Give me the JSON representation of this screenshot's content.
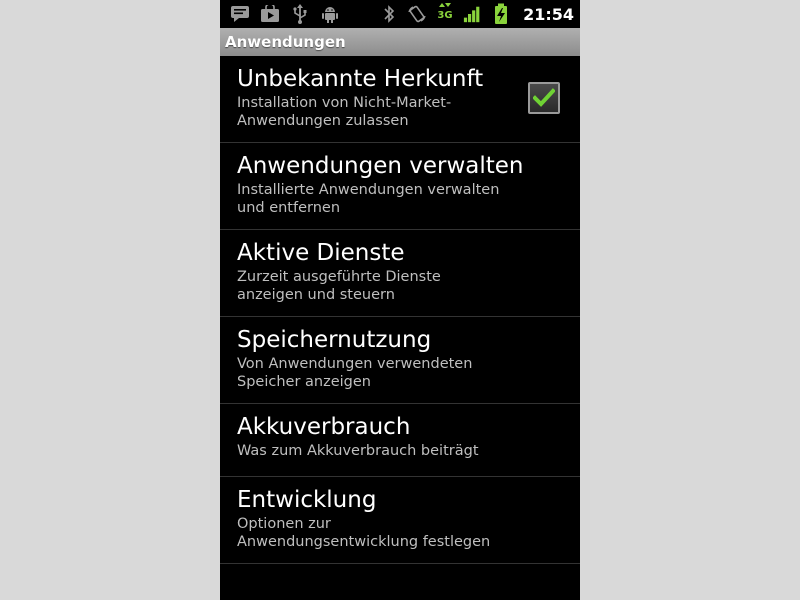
{
  "status_bar": {
    "left_icons": [
      "message-icon",
      "market-icon",
      "usb-icon",
      "android-debug-icon"
    ],
    "right_icons": [
      "bluetooth-icon",
      "rotate-icon",
      "network-3g-icon",
      "signal-icon",
      "battery-charging-icon"
    ],
    "network_type": "3G",
    "time": "21:54"
  },
  "title_bar": {
    "title": "Anwendungen"
  },
  "settings": [
    {
      "title": "Unbekannte Herkunft",
      "summary": "Installation von Nicht-Market-Anwendungen zulassen",
      "has_checkbox": true,
      "checked": true
    },
    {
      "title": "Anwendungen verwalten",
      "summary": "Installierte Anwendungen verwalten und entfernen"
    },
    {
      "title": "Aktive Dienste",
      "summary": "Zurzeit ausgeführte Dienste anzeigen und steuern"
    },
    {
      "title": "Speichernutzung",
      "summary": "Von Anwendungen verwendeten Speicher anzeigen"
    },
    {
      "title": "Akkuverbrauch",
      "summary": "Was zum Akkuverbrauch beiträgt"
    },
    {
      "title": "Entwicklung",
      "summary": "Optionen zur Anwendungsentwicklung festlegen"
    }
  ],
  "colors": {
    "accent_green": "#8ad33c",
    "check_green": "#6fd234",
    "title_bar_gray": "#9e9e9e"
  }
}
